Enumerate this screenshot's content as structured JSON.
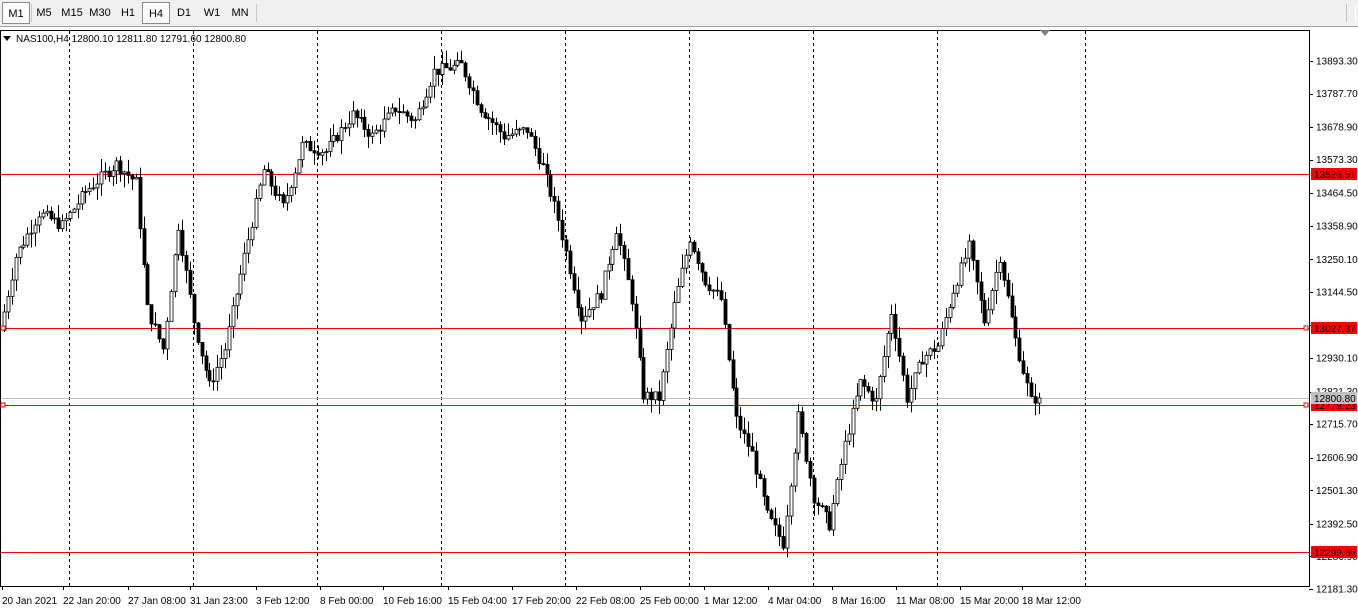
{
  "toolbar": {
    "timeframes": [
      "M1",
      "M5",
      "M15",
      "M30",
      "H1",
      "H4",
      "D1",
      "W1",
      "MN"
    ],
    "active_primary": "M1",
    "active_current": "H4"
  },
  "chart_info": {
    "symbol_line": "NAS100,H4  12800.10 12811.80 12791.60 12800.80"
  },
  "chart_data": {
    "type": "candlestick",
    "symbol": "NAS100",
    "timeframe": "H4",
    "ohlc_current": {
      "open": 12800.1,
      "high": 12811.8,
      "low": 12791.6,
      "close": 12800.8
    },
    "price_axis_labels": [
      "13893.30",
      "13787.70",
      "13678.90",
      "13573.30",
      "13464.50",
      "13358.90",
      "13250.10",
      "13144.50",
      "13035.70",
      "12930.10",
      "12821.30",
      "12715.70",
      "12606.90",
      "12501.30",
      "12392.50",
      "12286.90",
      "12181.30"
    ],
    "time_axis_labels": [
      "20 Jan 2021",
      "22 Jan 20:00",
      "27 Jan 08:00",
      "31 Jan 23:00",
      "3 Feb 12:00",
      "8 Feb 00:00",
      "10 Feb 16:00",
      "15 Feb 04:00",
      "17 Feb 20:00",
      "22 Feb 08:00",
      "25 Feb 00:00",
      "1 Mar 12:00",
      "4 Mar 04:00",
      "8 Mar 16:00",
      "11 Mar 08:00",
      "15 Mar 20:00",
      "18 Mar 12:00"
    ],
    "ylim": [
      12181.3,
      13893.3
    ],
    "horizontal_levels": [
      {
        "price": 13526.51,
        "label": "13526.51",
        "color": "#ff0000"
      },
      {
        "price": 13027.37,
        "label": "13027.37",
        "color": "#ff0000"
      },
      {
        "price": 12779.23,
        "label": "12779.23",
        "color": "#ff0000"
      },
      {
        "price": 12299.66,
        "label": "12299.66",
        "color": "#ff0000"
      }
    ],
    "bid_line": {
      "price": 12800.8,
      "label": "12800.80",
      "color": "#c0c0c0"
    },
    "path_points": [
      {
        "t": 0,
        "p": 13020
      },
      {
        "t": 4,
        "p": 13260
      },
      {
        "t": 10,
        "p": 13400
      },
      {
        "t": 16,
        "p": 13360
      },
      {
        "t": 22,
        "p": 13470
      },
      {
        "t": 30,
        "p": 13560
      },
      {
        "t": 35,
        "p": 13500
      },
      {
        "t": 38,
        "p": 13090
      },
      {
        "t": 42,
        "p": 12960
      },
      {
        "t": 46,
        "p": 13360
      },
      {
        "t": 50,
        "p": 13050
      },
      {
        "t": 54,
        "p": 12840
      },
      {
        "t": 58,
        "p": 12960
      },
      {
        "t": 63,
        "p": 13260
      },
      {
        "t": 68,
        "p": 13540
      },
      {
        "t": 73,
        "p": 13420
      },
      {
        "t": 78,
        "p": 13620
      },
      {
        "t": 84,
        "p": 13600
      },
      {
        "t": 91,
        "p": 13720
      },
      {
        "t": 96,
        "p": 13650
      },
      {
        "t": 102,
        "p": 13740
      },
      {
        "t": 107,
        "p": 13700
      },
      {
        "t": 112,
        "p": 13860
      },
      {
        "t": 119,
        "p": 13880
      },
      {
        "t": 124,
        "p": 13740
      },
      {
        "t": 130,
        "p": 13650
      },
      {
        "t": 136,
        "p": 13670
      },
      {
        "t": 140,
        "p": 13550
      },
      {
        "t": 144,
        "p": 13380
      },
      {
        "t": 150,
        "p": 13060
      },
      {
        "t": 155,
        "p": 13140
      },
      {
        "t": 159,
        "p": 13350
      },
      {
        "t": 163,
        "p": 13120
      },
      {
        "t": 166,
        "p": 12810
      },
      {
        "t": 170,
        "p": 12800
      },
      {
        "t": 174,
        "p": 13100
      },
      {
        "t": 178,
        "p": 13320
      },
      {
        "t": 182,
        "p": 13180
      },
      {
        "t": 186,
        "p": 13120
      },
      {
        "t": 190,
        "p": 12730
      },
      {
        "t": 194,
        "p": 12620
      },
      {
        "t": 198,
        "p": 12420
      },
      {
        "t": 202,
        "p": 12330
      },
      {
        "t": 206,
        "p": 12740
      },
      {
        "t": 210,
        "p": 12480
      },
      {
        "t": 214,
        "p": 12390
      },
      {
        "t": 218,
        "p": 12650
      },
      {
        "t": 222,
        "p": 12850
      },
      {
        "t": 226,
        "p": 12790
      },
      {
        "t": 230,
        "p": 13080
      },
      {
        "t": 234,
        "p": 12800
      },
      {
        "t": 238,
        "p": 12930
      },
      {
        "t": 242,
        "p": 12970
      },
      {
        "t": 246,
        "p": 13150
      },
      {
        "t": 250,
        "p": 13290
      },
      {
        "t": 254,
        "p": 13050
      },
      {
        "t": 258,
        "p": 13260
      },
      {
        "t": 262,
        "p": 12990
      },
      {
        "t": 266,
        "p": 12790
      },
      {
        "t": 267,
        "p": 12800
      }
    ]
  }
}
